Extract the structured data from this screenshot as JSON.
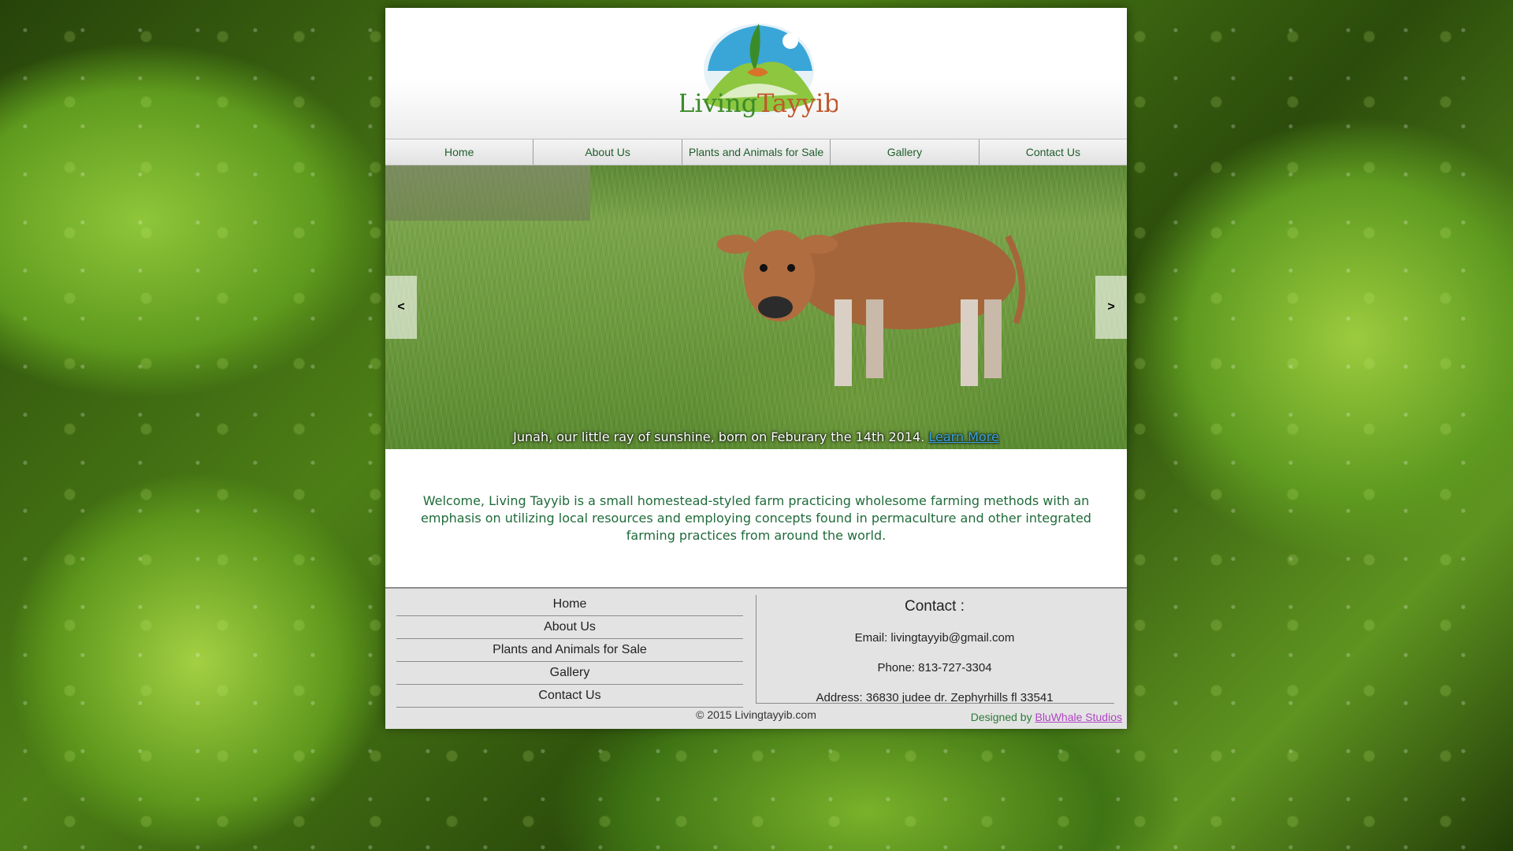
{
  "site": {
    "logo_text_1": "Living",
    "logo_text_2": "Tayyib"
  },
  "nav": [
    {
      "label": "Home"
    },
    {
      "label": "About Us"
    },
    {
      "label": "Plants and Animals for Sale"
    },
    {
      "label": "Gallery"
    },
    {
      "label": "Contact Us"
    }
  ],
  "slider": {
    "prev_label": "<",
    "next_label": ">",
    "caption": "Junah, our little ray of sunshine, born on Feburary the 14th 2014.",
    "learn_more": "Learn More"
  },
  "welcome": {
    "text": "Welcome,  Living Tayyib is a small homestead-styled farm practicing wholesome farming methods with an emphasis on utilizing local resources and employing concepts found in permaculture and other integrated farming practices from around the world."
  },
  "footer": {
    "nav": [
      {
        "label": "Home"
      },
      {
        "label": "About Us"
      },
      {
        "label": "Plants and Animals for Sale"
      },
      {
        "label": "Gallery"
      },
      {
        "label": "Contact Us"
      }
    ],
    "contact_title": "Contact :",
    "email": "Email: livingtayyib@gmail.com",
    "phone": "Phone: 813-727-3304",
    "address": "Address: 36830 judee dr. Zephyrhills fl 33541",
    "copyright": "© 2015 Livingtayyib.com",
    "designed_by": "Designed by ",
    "designer": "BluWhale Studios"
  },
  "colors": {
    "nav_text": "#1f5e2a",
    "welcome_text": "#1f6b3a",
    "designer_link": "#b044c4",
    "caption_link": "#3aa3e0"
  }
}
